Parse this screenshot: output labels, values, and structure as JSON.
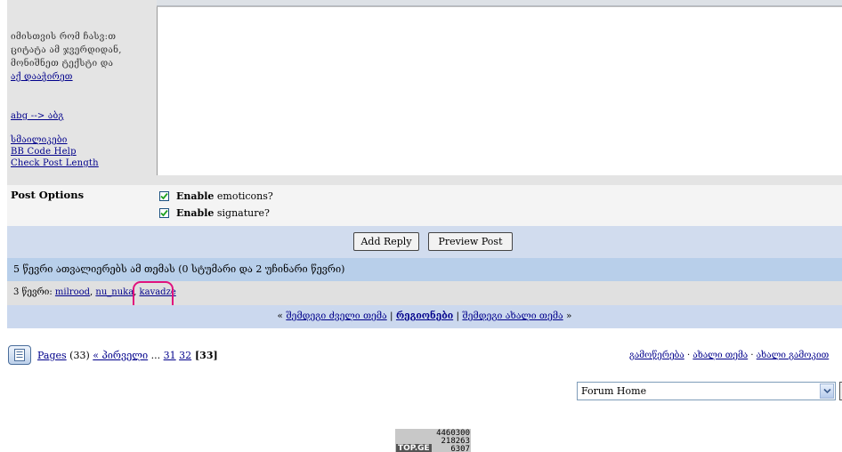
{
  "left_panel": {
    "quote_hint_lines": [
      "იმისთვის რომ ჩასვ:თ",
      "ციტატა ამ ჯვერდიდან,",
      "მონიშნეთ ტექსტი და"
    ],
    "quote_hint_link": "აქ დააჭირეთ",
    "translit_link": "abg --> აბგ",
    "smilies_link": "სმაილიკები",
    "bbcode_link": "BB Code Help",
    "check_length_link": "Check Post Length"
  },
  "post_options": {
    "label": "Post Options",
    "emoticons_bold": "Enable",
    "emoticons_rest": " emoticons?",
    "signature_bold": "Enable",
    "signature_rest": " signature?",
    "emoticons_checked": true,
    "signature_checked": true
  },
  "buttons": {
    "add_reply": "Add Reply",
    "preview": "Preview Post"
  },
  "readers": {
    "header": "5 წევრი ათვალიერებს ამ თემას (0 სტუმარი და 2 უჩინარი წევრი)",
    "prefix": "3 წევრი: ",
    "members": [
      "milrood",
      "nu_nuka",
      "kavadze"
    ],
    "separator": ", "
  },
  "thread_nav": {
    "open": "« ",
    "prev": "შემდეგი ძველი თემა",
    "sep1": " | ",
    "forum": "რეგიონები",
    "sep2": " | ",
    "next": "შემდეგი ახალი თემა",
    "close": " »"
  },
  "pages": {
    "label": "Pages",
    "count": " (33) ",
    "first": "« პირველი",
    "ellipsis": " ... ",
    "p31": "31",
    "p32": "32",
    "current": " [33]"
  },
  "top_links": {
    "track": "გამოწერება",
    "sep1": " · ",
    "new_topic": "ახალი თემა",
    "sep2": " · ",
    "new_poll": "ახალი გამოკით"
  },
  "forum_jump": {
    "selected": "Forum Home"
  },
  "counter": {
    "line1": "4460300",
    "line2": "218263",
    "line3": "6307",
    "logo": "TOP.GE"
  },
  "colors": {
    "link": "#00008b",
    "highlight": "#e0127e",
    "nav_bg": "#cbd8ee",
    "readers_bg": "#b8cfea"
  }
}
